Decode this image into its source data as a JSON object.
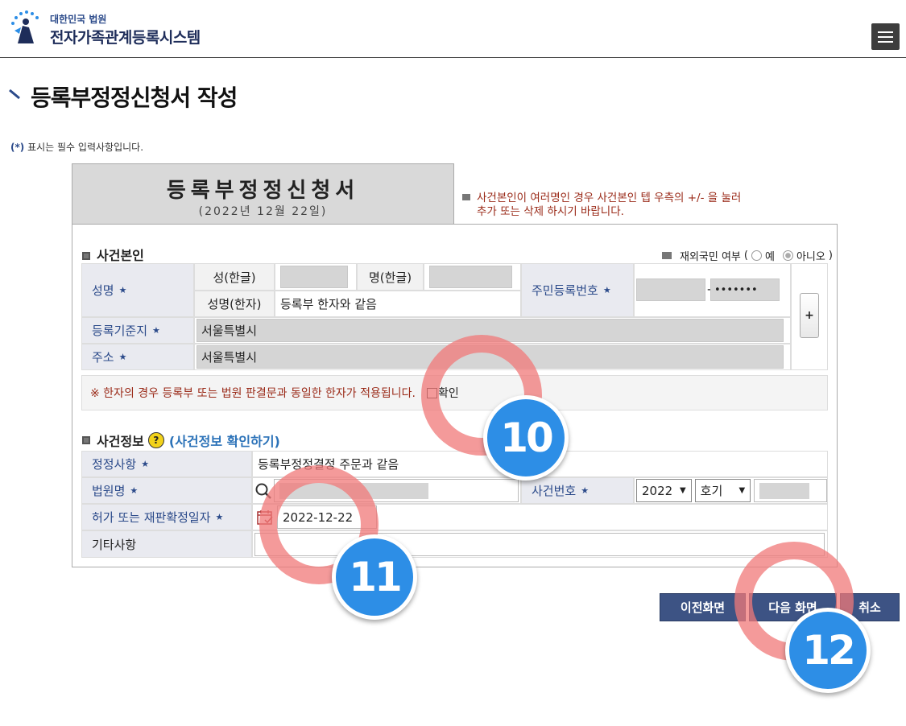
{
  "header": {
    "logo_sub": "대한민국 법원",
    "logo_main": "전자가족관계등록시스템"
  },
  "page": {
    "title": "등록부정정신청서 작성",
    "required_note_star": "(*)",
    "required_note": "표시는 필수 입력사항입니다."
  },
  "form_head": {
    "title": "등록부정정신청서",
    "date": "(2022년 12월 22일)"
  },
  "side_note": {
    "line1": "사건본인이 여러명인 경우 사건본인 텝 우측의 +/- 을 눌러",
    "line2": "추가 또는 삭제 하시기 바랍니다."
  },
  "principal": {
    "section_title": "사건본인",
    "overseas_label": "재외국민 여부",
    "overseas_yes": "예",
    "overseas_no": "아니오",
    "name_label": "성명",
    "surname_hangul_label": "성(한글)",
    "given_hangul_label": "명(한글)",
    "name_hanja_label": "성명(한자)",
    "name_hanja_value": "등록부 한자와 같음",
    "rrn_label": "주민등록번호",
    "rrn_back": "•••••••",
    "rrn_dash": "-",
    "reg_base_label": "등록기준지",
    "reg_base_value": "서울특별시",
    "address_label": "주소",
    "address_value": "서울특별시",
    "plus_label": "+",
    "hanja_notice": "※ 한자의 경우 등록부 또는 법원 판결문과 동일한 한자가 적용됩니다.",
    "confirm_label": "확인"
  },
  "case_info": {
    "section_title": "사건정보",
    "help_icon_text": "?",
    "check_link": "(사건정보 확인하기)",
    "correction_label": "정정사항",
    "correction_value": "등록부정정결정 주문과 같음",
    "court_label": "법원명",
    "case_no_label": "사건번호",
    "case_year": "2022",
    "case_type": "호기",
    "permit_date_label": "허가 또는 재판확정일자",
    "permit_date_value": "2022-12-22",
    "etc_label": "기타사항"
  },
  "buttons": {
    "prev": "이전화면",
    "next": "다음 화면",
    "cancel": "취소"
  },
  "annotations": {
    "badge_10": "10",
    "badge_11": "11",
    "badge_12": "12"
  },
  "colors": {
    "label_text": "#2b4a8a",
    "button_bg": "#3d5384",
    "notice_text": "#9a2a18",
    "ring": "#f07878",
    "badge": "#2d8ee6"
  }
}
